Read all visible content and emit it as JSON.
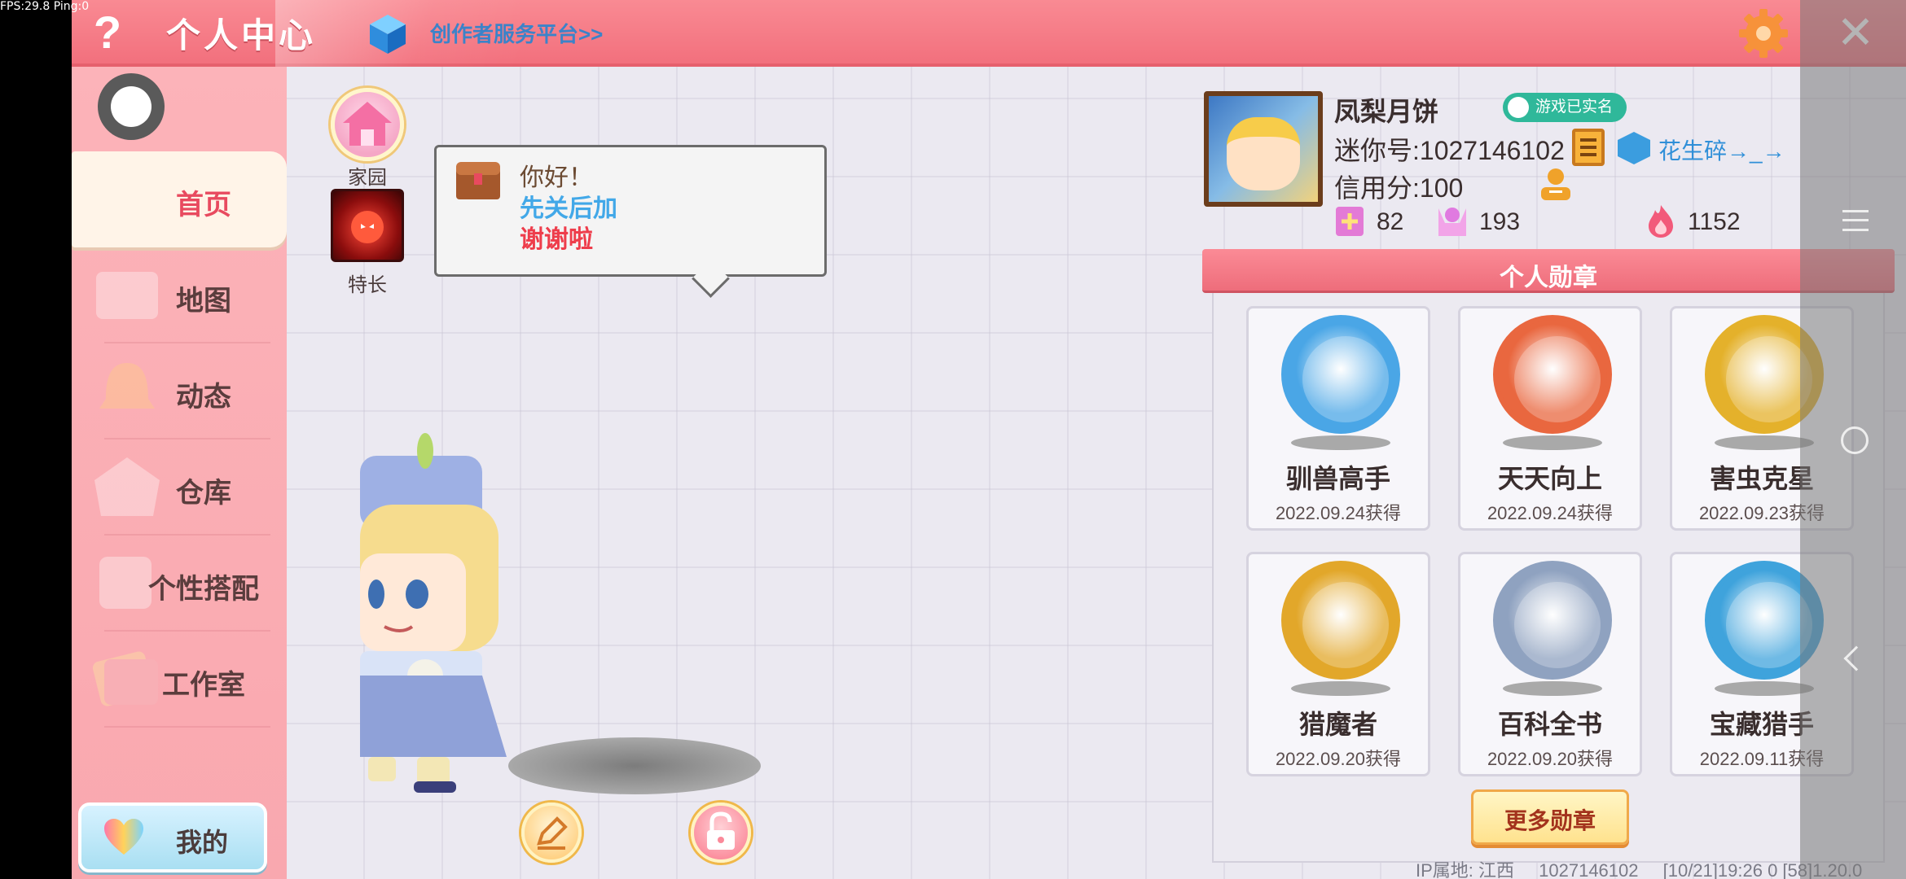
{
  "debug": {
    "fps": "FPS:29.8  Ping:0"
  },
  "header": {
    "help_label": "?",
    "title": "个人中心",
    "creator_link": "创作者服务平台>>",
    "close_label": "✕"
  },
  "sidebar": {
    "items": [
      {
        "label": "首页",
        "icon": "home-icon",
        "active": true
      },
      {
        "label": "地图",
        "icon": "map-icon"
      },
      {
        "label": "动态",
        "icon": "bell-icon"
      },
      {
        "label": "仓库",
        "icon": "warehouse-icon"
      },
      {
        "label": "个性搭配",
        "icon": "outfit-icon"
      },
      {
        "label": "工作室",
        "icon": "studio-icon"
      }
    ],
    "my_label": "我的"
  },
  "quick": {
    "home_label": "家园",
    "talent_label": "特长"
  },
  "bubble": {
    "line1": "你好！",
    "line2": "先关后加",
    "line3": "谢谢啦"
  },
  "profile": {
    "name": "凤梨月饼",
    "verified": "游戏已实名",
    "mini_id": "迷你号:1027146102",
    "friend_link": "花生碎→_→",
    "credit": "信用分:100",
    "stats": [
      {
        "icon": "plus-card-icon",
        "value": "82"
      },
      {
        "icon": "fans-icon",
        "value": "193"
      },
      {
        "icon": "flame-icon",
        "value": "1152"
      }
    ]
  },
  "medals": {
    "title": "个人勋章",
    "items": [
      {
        "name": "驯兽高手",
        "date": "2022.09.24获得",
        "color": "#4aa6e6"
      },
      {
        "name": "天天向上",
        "date": "2022.09.24获得",
        "color": "#e9673f"
      },
      {
        "name": "害虫克星",
        "date": "2022.09.23获得",
        "color": "#e4b12b"
      },
      {
        "name": "猎魔者",
        "date": "2022.09.20获得",
        "color": "#e2a72a"
      },
      {
        "name": "百科全书",
        "date": "2022.09.20获得",
        "color": "#8fa2c0"
      },
      {
        "name": "宝藏猎手",
        "date": "2022.09.11获得",
        "color": "#3fa3dc"
      }
    ],
    "more_label": "更多勋章"
  },
  "footer": {
    "ip": "IP属地: 江西",
    "uid": "1027146102",
    "version": "[10/21]19:26 0  [58]1.20.0"
  }
}
